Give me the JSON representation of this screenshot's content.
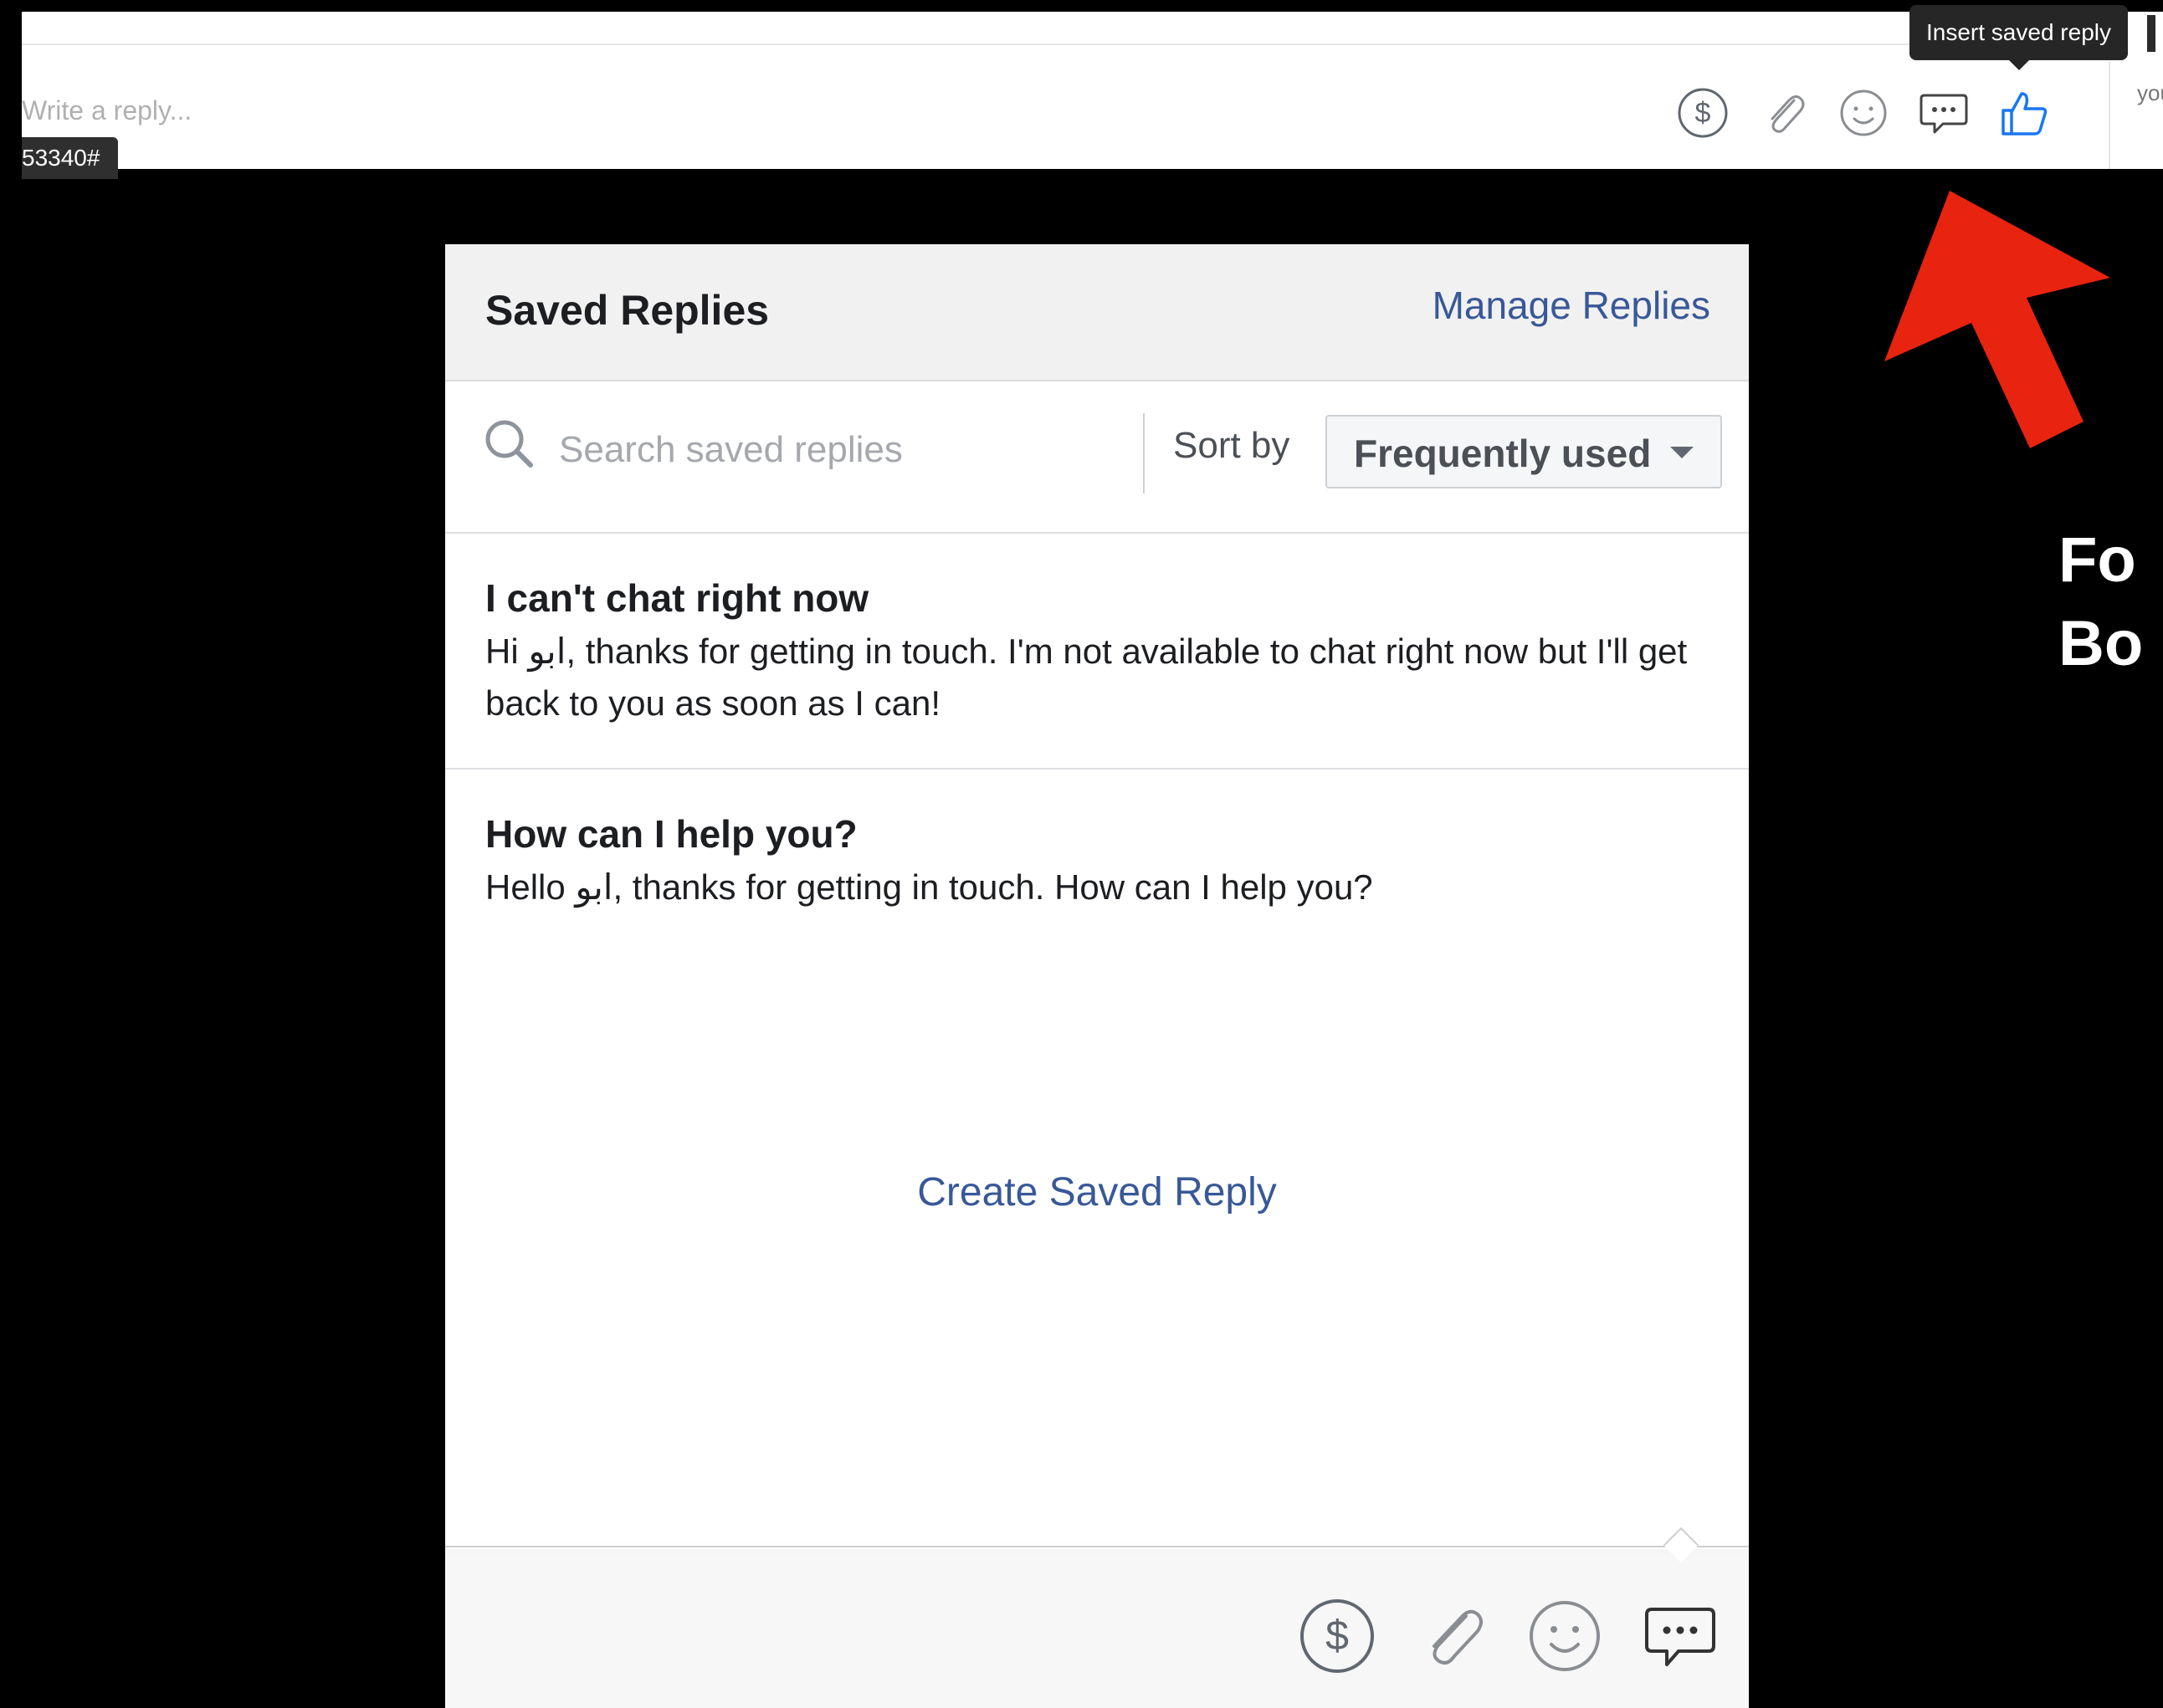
{
  "composer": {
    "placeholder": "Write a reply...",
    "id_tag": "53340#",
    "right_text": "your"
  },
  "tooltip": {
    "text": "Insert saved reply"
  },
  "annotation": {
    "line1": "Fo",
    "line2": "Bo"
  },
  "panel": {
    "title": "Saved Replies",
    "manage_link": "Manage Replies",
    "search_placeholder": "Search saved replies",
    "sort_label": "Sort by",
    "sort_value": "Frequently used",
    "replies": [
      {
        "title": "I can't chat right now",
        "body": "Hi ابو, thanks for getting in touch. I'm not available to chat right now but I'll get back to you as soon as I can!"
      },
      {
        "title": "How can I help you?",
        "body": "Hello ابو, thanks for getting in touch. How can I help you?"
      }
    ],
    "create_link": "Create Saved Reply"
  },
  "icons": {
    "top_toolbar": [
      "dollar-icon",
      "paperclip-icon",
      "smiley-icon",
      "saved-reply-icon",
      "thumbs-up-icon"
    ],
    "bottom_toolbar": [
      "dollar-icon",
      "paperclip-icon",
      "smiley-icon",
      "saved-reply-icon"
    ]
  },
  "colors": {
    "link": "#385898",
    "like_blue": "#1877f2",
    "arrow_red": "#e8230f"
  }
}
